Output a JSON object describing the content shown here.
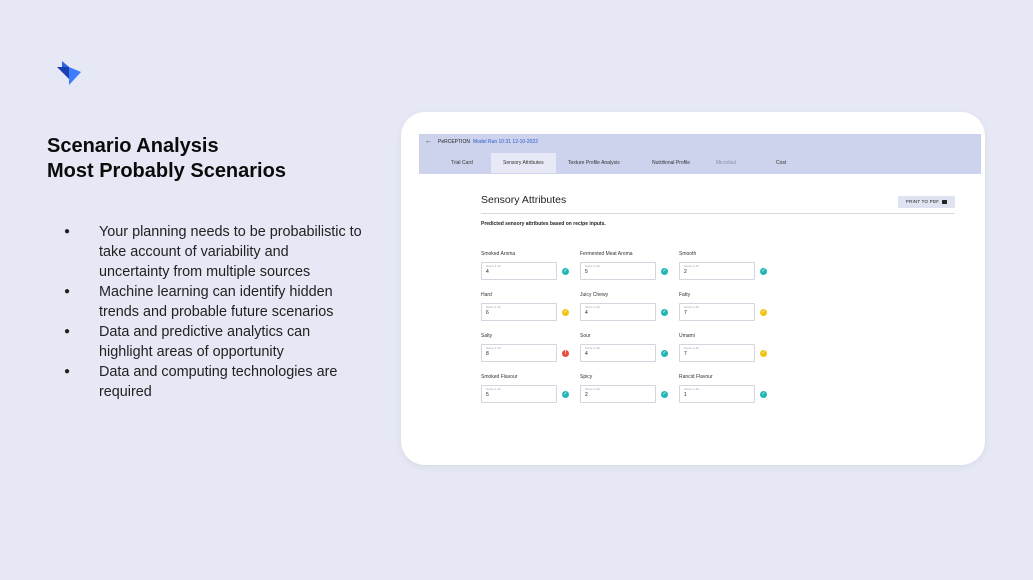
{
  "heading": {
    "line1": "Scenario Analysis",
    "line2": "Most Probably Scenarios"
  },
  "bullets": [
    "Your planning needs to be probabilistic to take account of variability and uncertainty from multiple sources",
    "Machine learning can identify hidden trends and probable future scenarios",
    "Data and predictive analytics can highlight areas of opportunity",
    "Data and computing technologies are required"
  ],
  "colors": {
    "background": "#e6e9f5",
    "topbar": "#cdd3ec",
    "ok": "#20b6b6",
    "warn": "#f1c40f",
    "bad": "#e74c3c",
    "logo_dark": "#1a3fb0",
    "logo_light": "#3d7bff"
  },
  "app": {
    "breadcrumb": {
      "back_icon": "arrow-left-icon",
      "product": "PeRCEPTION",
      "run": "Model Run 10:31 12-10-2022"
    },
    "tabs": [
      {
        "label": "Trial Card",
        "state": "normal"
      },
      {
        "label": "Sensory Attributes",
        "state": "active"
      },
      {
        "label": "Texture Profile Analysis",
        "state": "normal"
      },
      {
        "label": "Nutritional Profile",
        "state": "normal"
      },
      {
        "label": "Microbial",
        "state": "disabled"
      },
      {
        "label": "Cost",
        "state": "normal"
      }
    ],
    "section_title": "Sensory Attributes",
    "print_label": "PRINT TO PDF",
    "print_icon": "printer-icon",
    "subtitle": "Predicted sensory attributes based on recipe inputs.",
    "score_hint": "Score 1-10",
    "attributes": [
      {
        "label": "Smoked Aroma",
        "value": "4",
        "status": "ok"
      },
      {
        "label": "Fermented Meat Aroma",
        "value": "5",
        "status": "ok"
      },
      {
        "label": "Smooth",
        "value": "2",
        "status": "ok"
      },
      {
        "label": "Hard",
        "value": "6",
        "status": "warn"
      },
      {
        "label": "Juicy Chewy",
        "value": "4",
        "status": "ok"
      },
      {
        "label": "Fatty",
        "value": "7",
        "status": "warn"
      },
      {
        "label": "Salty",
        "value": "8",
        "status": "bad"
      },
      {
        "label": "Sour",
        "value": "4",
        "status": "ok"
      },
      {
        "label": "Umami",
        "value": "7",
        "status": "warn"
      },
      {
        "label": "Smoked Flavour",
        "value": "5",
        "status": "ok"
      },
      {
        "label": "Spicy",
        "value": "2",
        "status": "ok"
      },
      {
        "label": "Rancid Flavour",
        "value": "1",
        "status": "ok"
      }
    ]
  }
}
